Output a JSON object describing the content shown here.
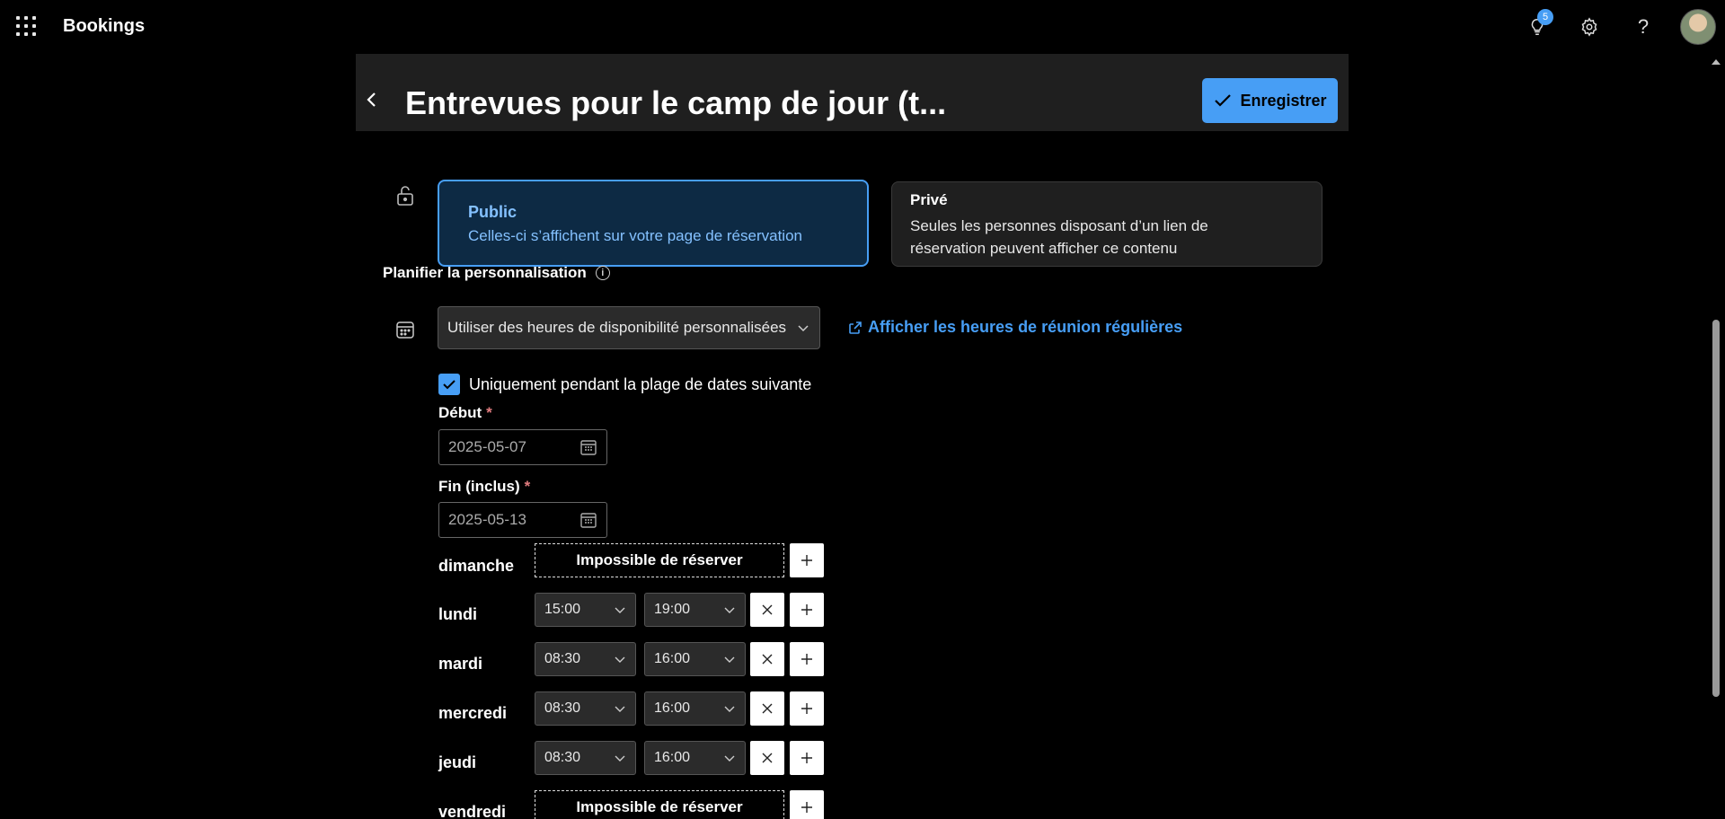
{
  "topbar": {
    "app_name": "Bookings",
    "notification_count": "5"
  },
  "header": {
    "title": "Entrevues pour le camp de jour (t...",
    "save_label": "Enregistrer"
  },
  "visibility": {
    "public_title": "Public",
    "public_desc": "Celles-ci s’affichent sur votre page de réservation",
    "private_title": "Privé",
    "private_desc": "Seules les personnes disposant d’un lien de réservation peuvent afficher ce contenu"
  },
  "schedule": {
    "section_title": "Planifier la personnalisation",
    "dropdown_value": "Utiliser des heures de disponibilité personnalisées",
    "link_label": "Afficher les heures de réunion régulières",
    "checkbox_label": "Uniquement pendant la plage de dates suivante",
    "start_label": "Début",
    "start_value": "2025-05-07",
    "end_label": "Fin (inclus)",
    "end_value": "2025-05-13",
    "required_mark": "*",
    "unavailable_label": "Impossible de réserver",
    "days": [
      {
        "name": "dimanche"
      },
      {
        "name": "lundi",
        "start": "15:00",
        "end": "19:00"
      },
      {
        "name": "mardi",
        "start": "08:30",
        "end": "16:00"
      },
      {
        "name": "mercredi",
        "start": "08:30",
        "end": "16:00"
      },
      {
        "name": "jeudi",
        "start": "08:30",
        "end": "16:00"
      },
      {
        "name": "vendredi"
      }
    ]
  },
  "colors": {
    "accent": "#479ef5",
    "public_card_bg": "#0d2a44",
    "required": "#e37d80"
  }
}
